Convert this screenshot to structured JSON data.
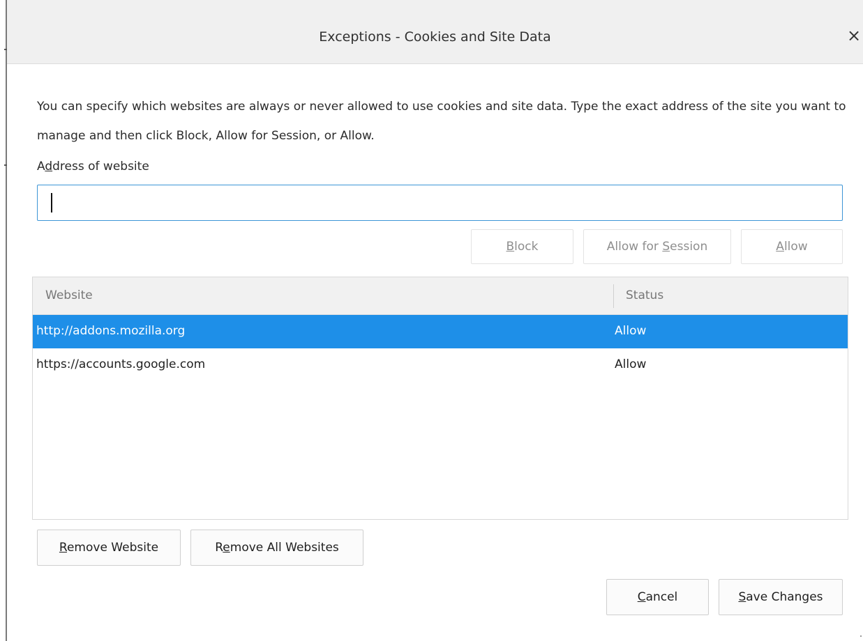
{
  "dialog": {
    "title": "Exceptions - Cookies and Site Data",
    "close_label": "×"
  },
  "description": "You can specify which websites are always or never allowed to use cookies and site data. Type the exact address of the site you want to manage and then click Block, Allow for Session, or Allow.",
  "address": {
    "label_accesskey": "d",
    "label_pre": "A",
    "label_post": "dress of website",
    "value": "",
    "placeholder": ""
  },
  "actions": {
    "block": {
      "pre": "",
      "key": "B",
      "post": "lock"
    },
    "allow_session": {
      "pre": "Allow for ",
      "key": "S",
      "post": "ession"
    },
    "allow": {
      "pre": "",
      "key": "A",
      "post": "llow"
    }
  },
  "table": {
    "columns": [
      "Website",
      "Status"
    ],
    "rows": [
      {
        "site": "http://addons.mozilla.org",
        "status": "Allow",
        "selected": true
      },
      {
        "site": "https://accounts.google.com",
        "status": "Allow",
        "selected": false
      }
    ]
  },
  "remove": {
    "remove_website": {
      "key": "R",
      "post": "emove Website"
    },
    "remove_all": {
      "pre": "R",
      "key": "e",
      "post": "move All Websites"
    }
  },
  "footer": {
    "cancel": {
      "key": "C",
      "post": "ancel"
    },
    "save": {
      "key": "S",
      "post": "ave Changes"
    }
  },
  "colors": {
    "selection": "#1e8fe8",
    "input_focus_border": "#3c95d6"
  }
}
